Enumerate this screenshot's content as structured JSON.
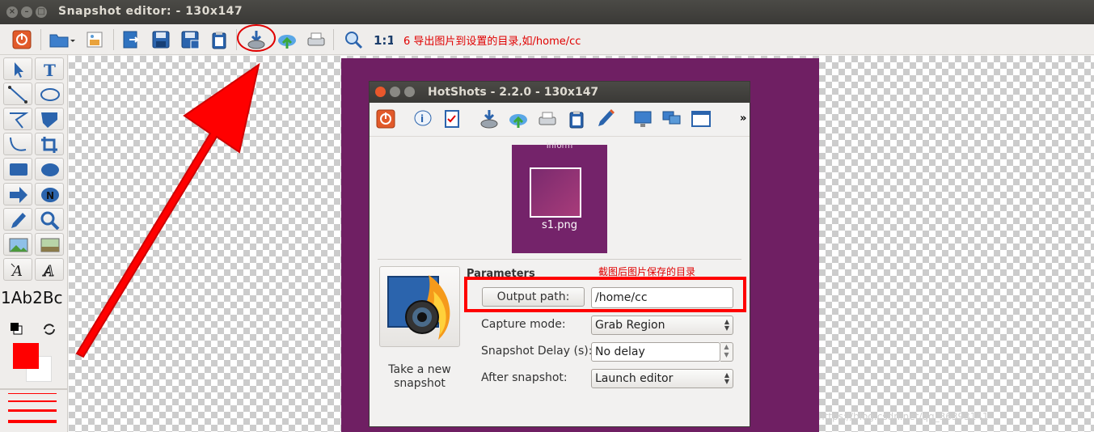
{
  "window": {
    "title": "Snapshot editor:  - 130x147"
  },
  "annotations": {
    "top": "6  导出图片到设置的目录,如/home/cc",
    "params": "截图后图片保存的目录"
  },
  "colors": {
    "accent_red": "#ff0000",
    "snapshot_bg": "#6f1f63",
    "primary_color": "#ff0000",
    "secondary_color": "#ffffff"
  },
  "toolbar": {
    "icons": [
      "power-icon",
      "open-folder-icon",
      "image-icon",
      "export-icon",
      "save-icon",
      "save-as-icon",
      "clipboard-icon",
      "save-to-disk-icon",
      "upload-icon",
      "print-icon",
      "zoom-fit-icon",
      "zoom-1-1-icon"
    ],
    "zoom_label": "1:1"
  },
  "tools": {
    "sample_text": "1Ab2Bc",
    "text_tool_label": "T",
    "ellipse_tool_label": "N"
  },
  "inner_window": {
    "title": "HotShots - 2.2.0 - 130x147",
    "more_label": "»",
    "thumbnail": {
      "label": "s1.png",
      "top_label": "Inform"
    },
    "parameters_label": "Parameters",
    "take_snapshot_label": "Take a new snapshot",
    "output_button_label": "Output path:",
    "output_path_value": "/home/cc",
    "capture_mode_label": "Capture mode:",
    "capture_mode_value": "Grab Region",
    "snapshot_delay_label": "Snapshot Delay (s):",
    "snapshot_delay_value": "No delay",
    "after_snapshot_label": "After snapshot:",
    "after_snapshot_value": "Launch editor"
  },
  "watermark": "https://blog.csdn.net/qq_36393141"
}
